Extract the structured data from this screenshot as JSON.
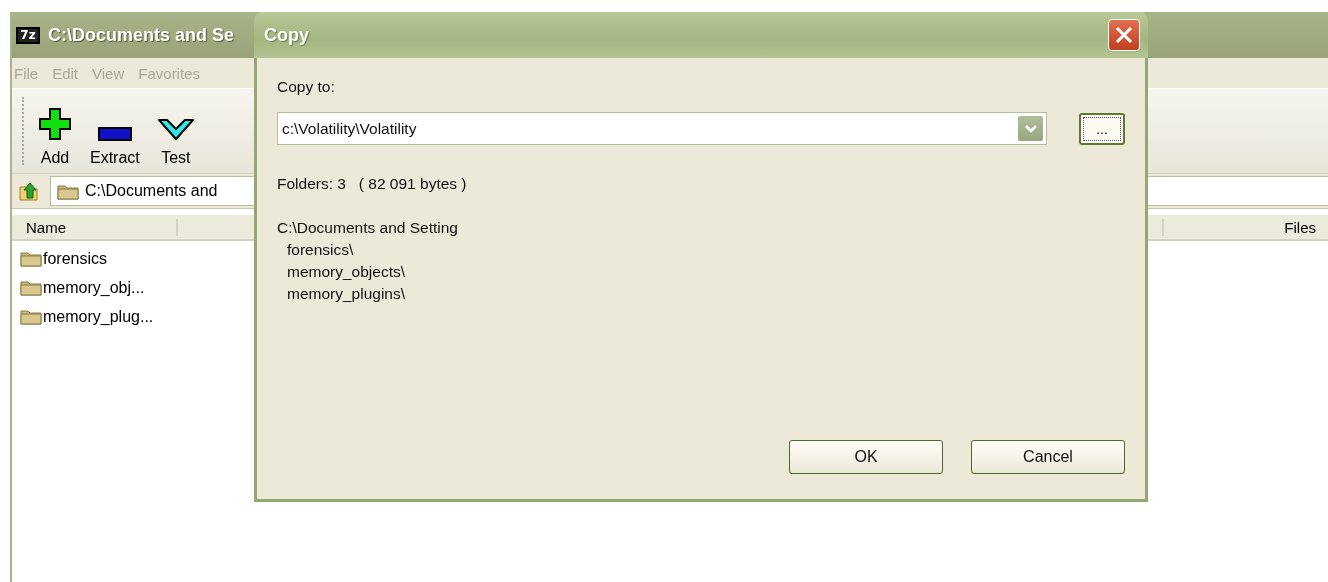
{
  "main_window": {
    "icon_text": "7z",
    "title": "C:\\Documents and Se",
    "menu": [
      "File",
      "Edit",
      "View",
      "Favorites"
    ],
    "toolbar": [
      {
        "label": "Add",
        "kind": "add"
      },
      {
        "label": "Extract",
        "kind": "extract"
      },
      {
        "label": "Test",
        "kind": "test"
      }
    ],
    "address": "C:\\Documents and",
    "columns": [
      {
        "label": "Name"
      },
      {
        "label": "Files"
      }
    ],
    "rows": [
      {
        "name": "forensics"
      },
      {
        "name": "memory_obj..."
      },
      {
        "name": "memory_plug..."
      }
    ]
  },
  "dialog": {
    "title": "Copy",
    "label": "Copy to:",
    "path": "c:\\Volatility\\Volatility",
    "browse": "...",
    "summary": "Folders: 3   ( 82 091 bytes )",
    "source": "C:\\Documents and Setting",
    "items": [
      "forensics\\",
      "memory_objects\\",
      "memory_plugins\\"
    ],
    "buttons": [
      "OK",
      "Cancel"
    ]
  }
}
